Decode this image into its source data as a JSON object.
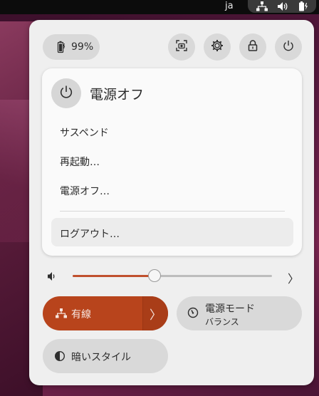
{
  "topbar": {
    "language": "ja",
    "icons": [
      "network-wired-icon",
      "volume-icon",
      "battery-charging-icon"
    ]
  },
  "quick_settings": {
    "battery": {
      "percent_label": "99%",
      "icon": "battery-charging-icon"
    },
    "buttons": [
      "screenshot-icon",
      "settings-icon",
      "lock-icon",
      "power-icon"
    ]
  },
  "power_menu": {
    "title": "電源オフ",
    "items": [
      "サスペンド",
      "再起動…",
      "電源オフ…",
      "ログアウト…"
    ]
  },
  "volume": {
    "level": 0.41,
    "icon": "volume-low-icon"
  },
  "toggles": {
    "wired": {
      "label": "有線",
      "active": true,
      "accent": "#b8441c"
    },
    "power_mode": {
      "title": "電源モード",
      "subtitle": "バランス"
    },
    "dark_style": {
      "label": "暗いスタイル"
    }
  }
}
